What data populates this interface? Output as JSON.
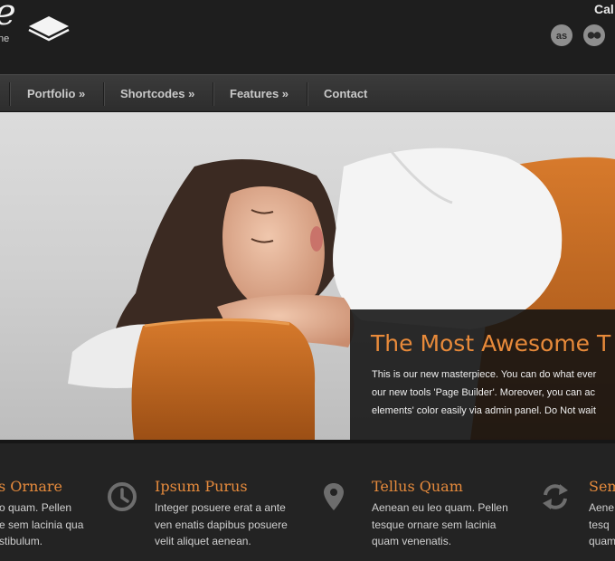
{
  "header": {
    "logo_letter": "e",
    "logo_sub": "ne",
    "cta_text": "Cal",
    "social_icons": [
      "lastfm-icon",
      "flickr-icon"
    ]
  },
  "nav": {
    "items": [
      {
        "label": "Portfolio »"
      },
      {
        "label": "Shortcodes »"
      },
      {
        "label": "Features »"
      },
      {
        "label": "Contact"
      }
    ]
  },
  "hero": {
    "title": "The Most Awesome T",
    "lines": [
      "This is our new masterpiece. You can do what ever",
      "our new tools 'Page Builder'. Moreover, you can ac",
      "elements' color easily via admin panel. Do Not wait"
    ]
  },
  "features": [
    {
      "icon": "none",
      "title": "s Ornare",
      "lines": [
        "o quam. Pellen",
        "e sem lacinia qua",
        "stibulum."
      ]
    },
    {
      "icon": "clock-icon",
      "title": "Ipsum Purus",
      "lines": [
        "Integer posuere erat a ante",
        "ven enatis dapibus posuere",
        "velit aliquet aenean."
      ]
    },
    {
      "icon": "map-pin-icon",
      "title": "Tellus Quam",
      "lines": [
        "Aenean eu leo quam. Pellen",
        "tesque ornare sem lacinia",
        "quam venenatis."
      ]
    },
    {
      "icon": "refresh-icon",
      "title": "Sem",
      "lines": [
        "Aene",
        "tesq",
        "quam"
      ]
    }
  ],
  "colors": {
    "accent": "#e58a3c",
    "header_bg": "#1e1e1e",
    "nav_bg": "#353535",
    "footer_bg": "#232323"
  }
}
